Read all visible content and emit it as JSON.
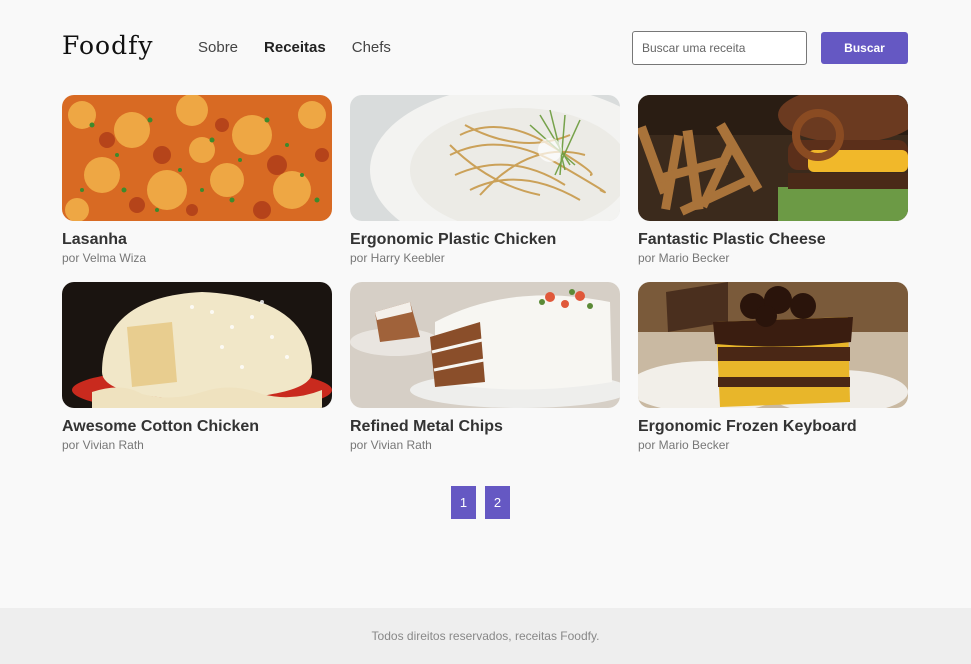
{
  "brand": {
    "name": "Foodfy"
  },
  "nav": [
    {
      "label": "Sobre",
      "active": false
    },
    {
      "label": "Receitas",
      "active": true
    },
    {
      "label": "Chefs",
      "active": false
    }
  ],
  "search": {
    "placeholder": "Buscar uma receita",
    "button_label": "Buscar"
  },
  "recipes": [
    {
      "title": "Lasanha",
      "author": "por Velma Wiza"
    },
    {
      "title": "Ergonomic Plastic Chicken",
      "author": "por Harry Keebler"
    },
    {
      "title": "Fantastic Plastic Cheese",
      "author": "por Mario Becker"
    },
    {
      "title": "Awesome Cotton Chicken",
      "author": "por Vivian Rath"
    },
    {
      "title": "Refined Metal Chips",
      "author": "por Vivian Rath"
    },
    {
      "title": "Ergonomic Frozen Keyboard",
      "author": "por Mario Becker"
    }
  ],
  "pagination": {
    "pages": [
      "1",
      "2"
    ]
  },
  "footer": {
    "text": "Todos direitos reservados, receitas Foodfy."
  },
  "colors": {
    "accent": "#6558c3",
    "background": "#f9f9f9",
    "footer_bg": "#eeeeee"
  }
}
